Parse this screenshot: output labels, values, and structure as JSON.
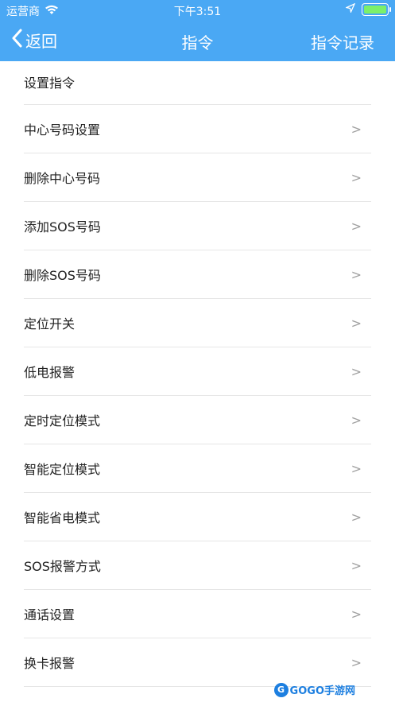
{
  "status_bar": {
    "carrier": "运营商",
    "time": "下午3:51"
  },
  "nav": {
    "back_label": "返回",
    "title": "指令",
    "right_label": "指令记录"
  },
  "section_title": "设置指令",
  "items": [
    {
      "label": "中心号码设置",
      "arrow": ">"
    },
    {
      "label": "删除中心号码",
      "arrow": ">"
    },
    {
      "label": "添加SOS号码",
      "arrow": ">"
    },
    {
      "label": "删除SOS号码",
      "arrow": ">"
    },
    {
      "label": "定位开关",
      "arrow": ">"
    },
    {
      "label": "低电报警",
      "arrow": ">"
    },
    {
      "label": "定时定位模式",
      "arrow": ">"
    },
    {
      "label": "智能定位模式",
      "arrow": ">"
    },
    {
      "label": "智能省电模式",
      "arrow": ">"
    },
    {
      "label": "SOS报警方式",
      "arrow": ">"
    },
    {
      "label": "通话设置",
      "arrow": ">"
    },
    {
      "label": "换卡报警",
      "arrow": ">"
    }
  ],
  "watermark": {
    "logo_letter": "G",
    "text": "GOGO手游网"
  },
  "colors": {
    "header": "#4aa8f4",
    "divider": "#e6e6e6",
    "arrow": "#a0a0a0"
  }
}
